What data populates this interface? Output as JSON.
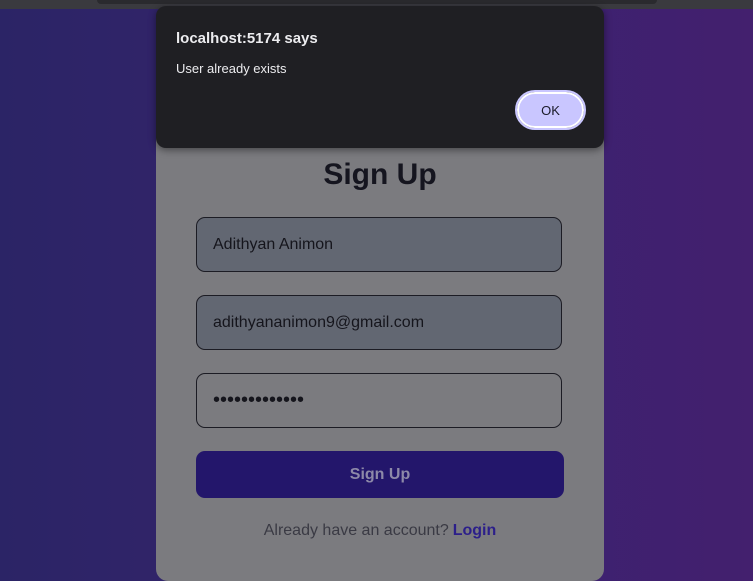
{
  "card": {
    "title": "Sign Up",
    "name_value": "Adithyan Animon",
    "email_value": "adithyananimon9@gmail.com",
    "password_masked": "•••••••••••••",
    "submit_label": "Sign Up",
    "footer_text": "Already have an account?",
    "login_link": "Login"
  },
  "dialog": {
    "title": "localhost:5174 says",
    "message": "User already exists",
    "ok_label": "OK"
  }
}
